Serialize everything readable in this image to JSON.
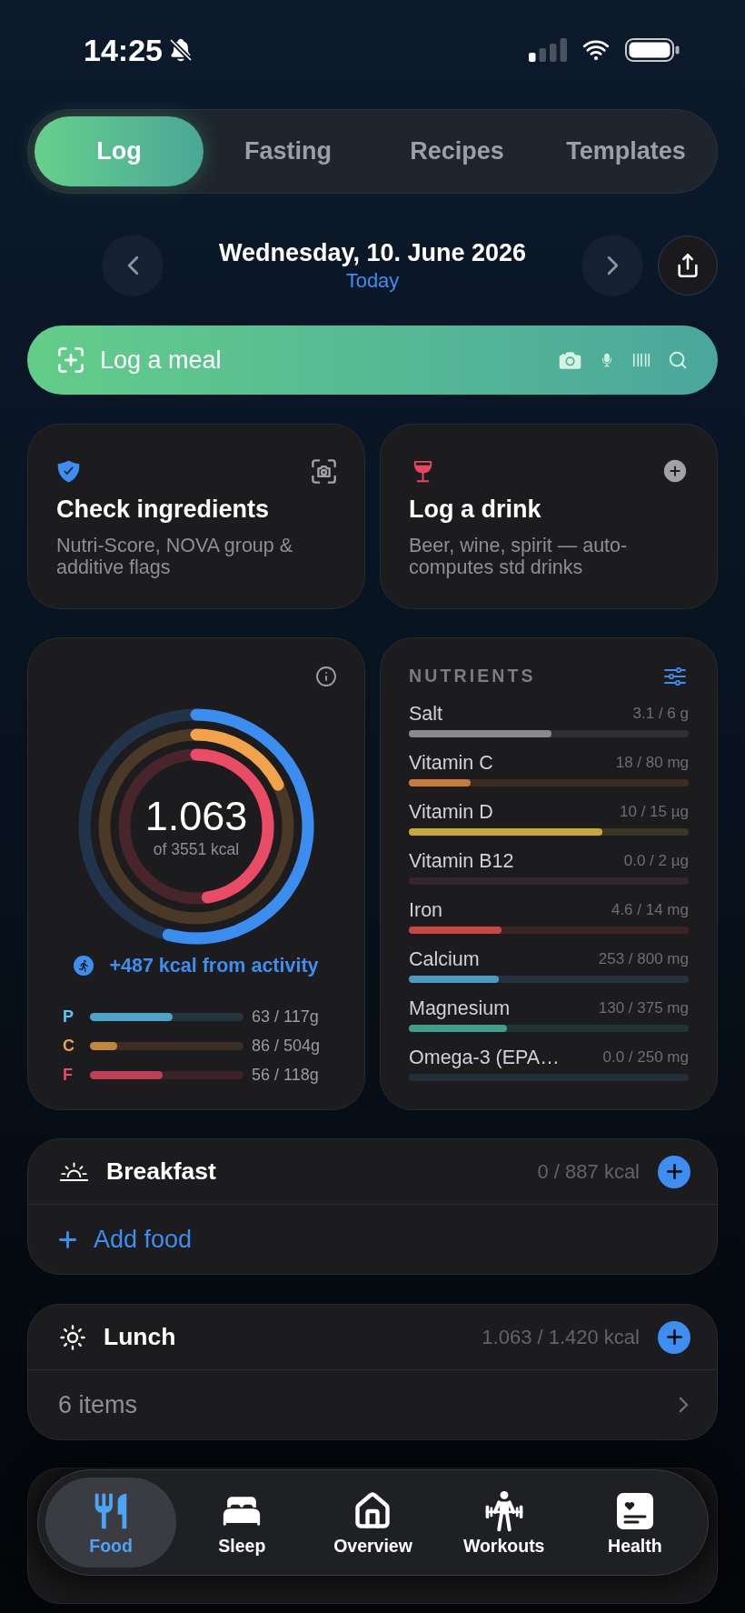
{
  "status_bar": {
    "time": "14:25"
  },
  "tabs": [
    {
      "label": "Log",
      "selected": true
    },
    {
      "label": "Fasting",
      "selected": false
    },
    {
      "label": "Recipes",
      "selected": false
    },
    {
      "label": "Templates",
      "selected": false
    }
  ],
  "date_nav": {
    "date": "Wednesday, 10. June 2026",
    "relative_day": "Today"
  },
  "log_meal": {
    "label": "Log a meal"
  },
  "action_cards": [
    {
      "title": "Check ingredients",
      "subtitle": "Nutri-Score, NOVA group & additive flags"
    },
    {
      "title": "Log a drink",
      "subtitle": "Beer, wine, spirit — auto-computes std drinks"
    }
  ],
  "calories": {
    "value": "1.063",
    "goal": "of 3551 kcal",
    "rings": [
      {
        "color": "#3b8ef0"
      },
      {
        "color": "#f2a24a"
      },
      {
        "color": "#ea4b65"
      }
    ],
    "activity": "+487 kcal from activity",
    "macros": [
      {
        "letter": "P",
        "color": "#5ac8fa",
        "reading": "63 / 117g",
        "level": 0.54
      },
      {
        "letter": "C",
        "color": "#f2a24a",
        "reading": "86 / 504g",
        "level": 0.175
      },
      {
        "letter": "F",
        "color": "#ea4b65",
        "reading": "56 / 118g",
        "level": 0.475
      }
    ]
  },
  "nutrients": {
    "title": "NUTRIENTS",
    "items": [
      {
        "name": "Salt",
        "reading": "3.1 / 6 g",
        "level": 0.51,
        "color": "#8a8a8e"
      },
      {
        "name": "Vitamin C",
        "reading": "18 / 80 mg",
        "level": 0.22,
        "color": "#c97b3a"
      },
      {
        "name": "Vitamin D",
        "reading": "10 / 15 µg",
        "level": 0.69,
        "color": "#c9a935"
      },
      {
        "name": "Vitamin B12",
        "reading": "0.0 / 2 µg",
        "color": "#36252f"
      },
      {
        "name": "Iron",
        "reading": "4.6 / 14 mg",
        "level": 0.33,
        "color": "#c94646"
      },
      {
        "name": "Calcium",
        "reading": "253 / 800 mg",
        "level": 0.32,
        "color": "#4a9cc4"
      },
      {
        "name": "Magnesium",
        "reading": "130 / 375 mg",
        "level": 0.35,
        "color": "#3e9f8a"
      },
      {
        "name": "Omega-3 (EPA…",
        "reading": "0.0 / 250 mg",
        "color": "#222f39"
      }
    ]
  },
  "meals": [
    {
      "name": "Breakfast",
      "reading": "0 / 887 kcal",
      "footer": {
        "kind": "add",
        "label": "Add food"
      }
    },
    {
      "name": "Lunch",
      "reading": "1.063 / 1.420 kcal",
      "footer": {
        "kind": "items",
        "label": "6 items"
      }
    }
  ],
  "nav": [
    {
      "label": "Food",
      "selected": true
    },
    {
      "label": "Sleep",
      "selected": false
    },
    {
      "label": "Overview",
      "selected": false
    },
    {
      "label": "Workouts",
      "selected": false
    },
    {
      "label": "Health",
      "selected": false
    }
  ]
}
